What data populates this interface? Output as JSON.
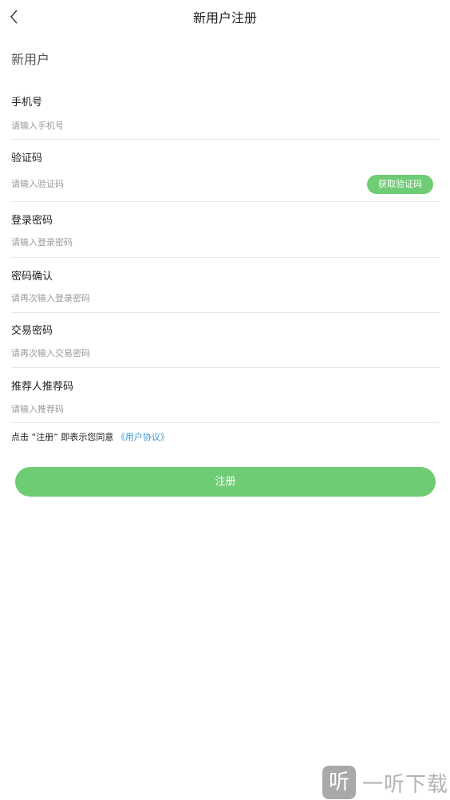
{
  "header": {
    "back_icon": "chevron-left-icon",
    "title": "新用户注册"
  },
  "section_title": "新用户",
  "form": {
    "phone": {
      "label": "手机号",
      "placeholder": "请输入手机号"
    },
    "code": {
      "label": "验证码",
      "placeholder": "请输入验证码",
      "button": "获取验证码"
    },
    "password": {
      "label": "登录密码",
      "placeholder": "请输入登录密码"
    },
    "password_confirm": {
      "label": "密码确认",
      "placeholder": "请再次输入登录密码"
    },
    "trade_password": {
      "label": "交易密码",
      "placeholder": "请再次输入交易密码"
    },
    "referrer": {
      "label": "推荐人推荐码",
      "placeholder": "请输入推荐码"
    }
  },
  "agreement": {
    "text": "点击 “注册” 即表示您同意",
    "link": "《用户协议》"
  },
  "submit_label": "注册",
  "watermark": {
    "logo_char": "听",
    "text": "一听下载"
  },
  "colors": {
    "accent": "#6ecc74",
    "link": "#3a98d6",
    "divider": "#e6e6e6",
    "placeholder": "#9a9a9a"
  }
}
